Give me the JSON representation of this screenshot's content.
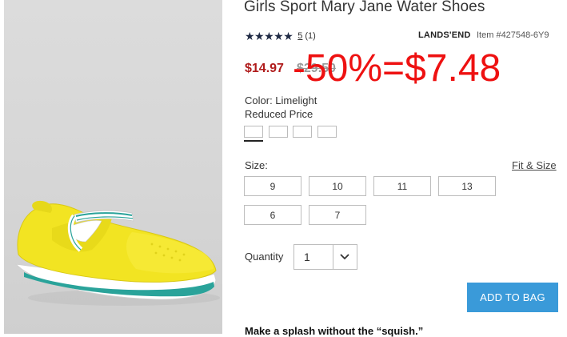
{
  "product": {
    "title": "Girls Sport Mary Jane Water Shoes",
    "stars": "★★★★★",
    "review_count": "5",
    "review_count_paren": "(1)",
    "brand": "LANDS'END",
    "item_number": "Item #427548-6Y9"
  },
  "pricing": {
    "sale_price": "$14.97",
    "original_price": "$29.50",
    "overlay_text": "-50%=$7.48",
    "overlay_color": "#ee1111"
  },
  "options": {
    "color_label": "Color: Limelight",
    "reduced_label": "Reduced Price",
    "size_label": "Size:",
    "fit_link": "Fit & Size",
    "sizes": [
      "9",
      "10",
      "11",
      "13",
      "6",
      "7"
    ]
  },
  "quantity": {
    "label": "Quantity",
    "value": "1"
  },
  "actions": {
    "add_to_bag": "ADD TO BAG",
    "button_color": "#3a9ad9"
  },
  "description": {
    "heading": "Make a splash without the “squish.”"
  },
  "icons": {
    "quantity_dropdown": "chevron-down-icon",
    "product_image": "yellow-mary-jane-shoe"
  }
}
